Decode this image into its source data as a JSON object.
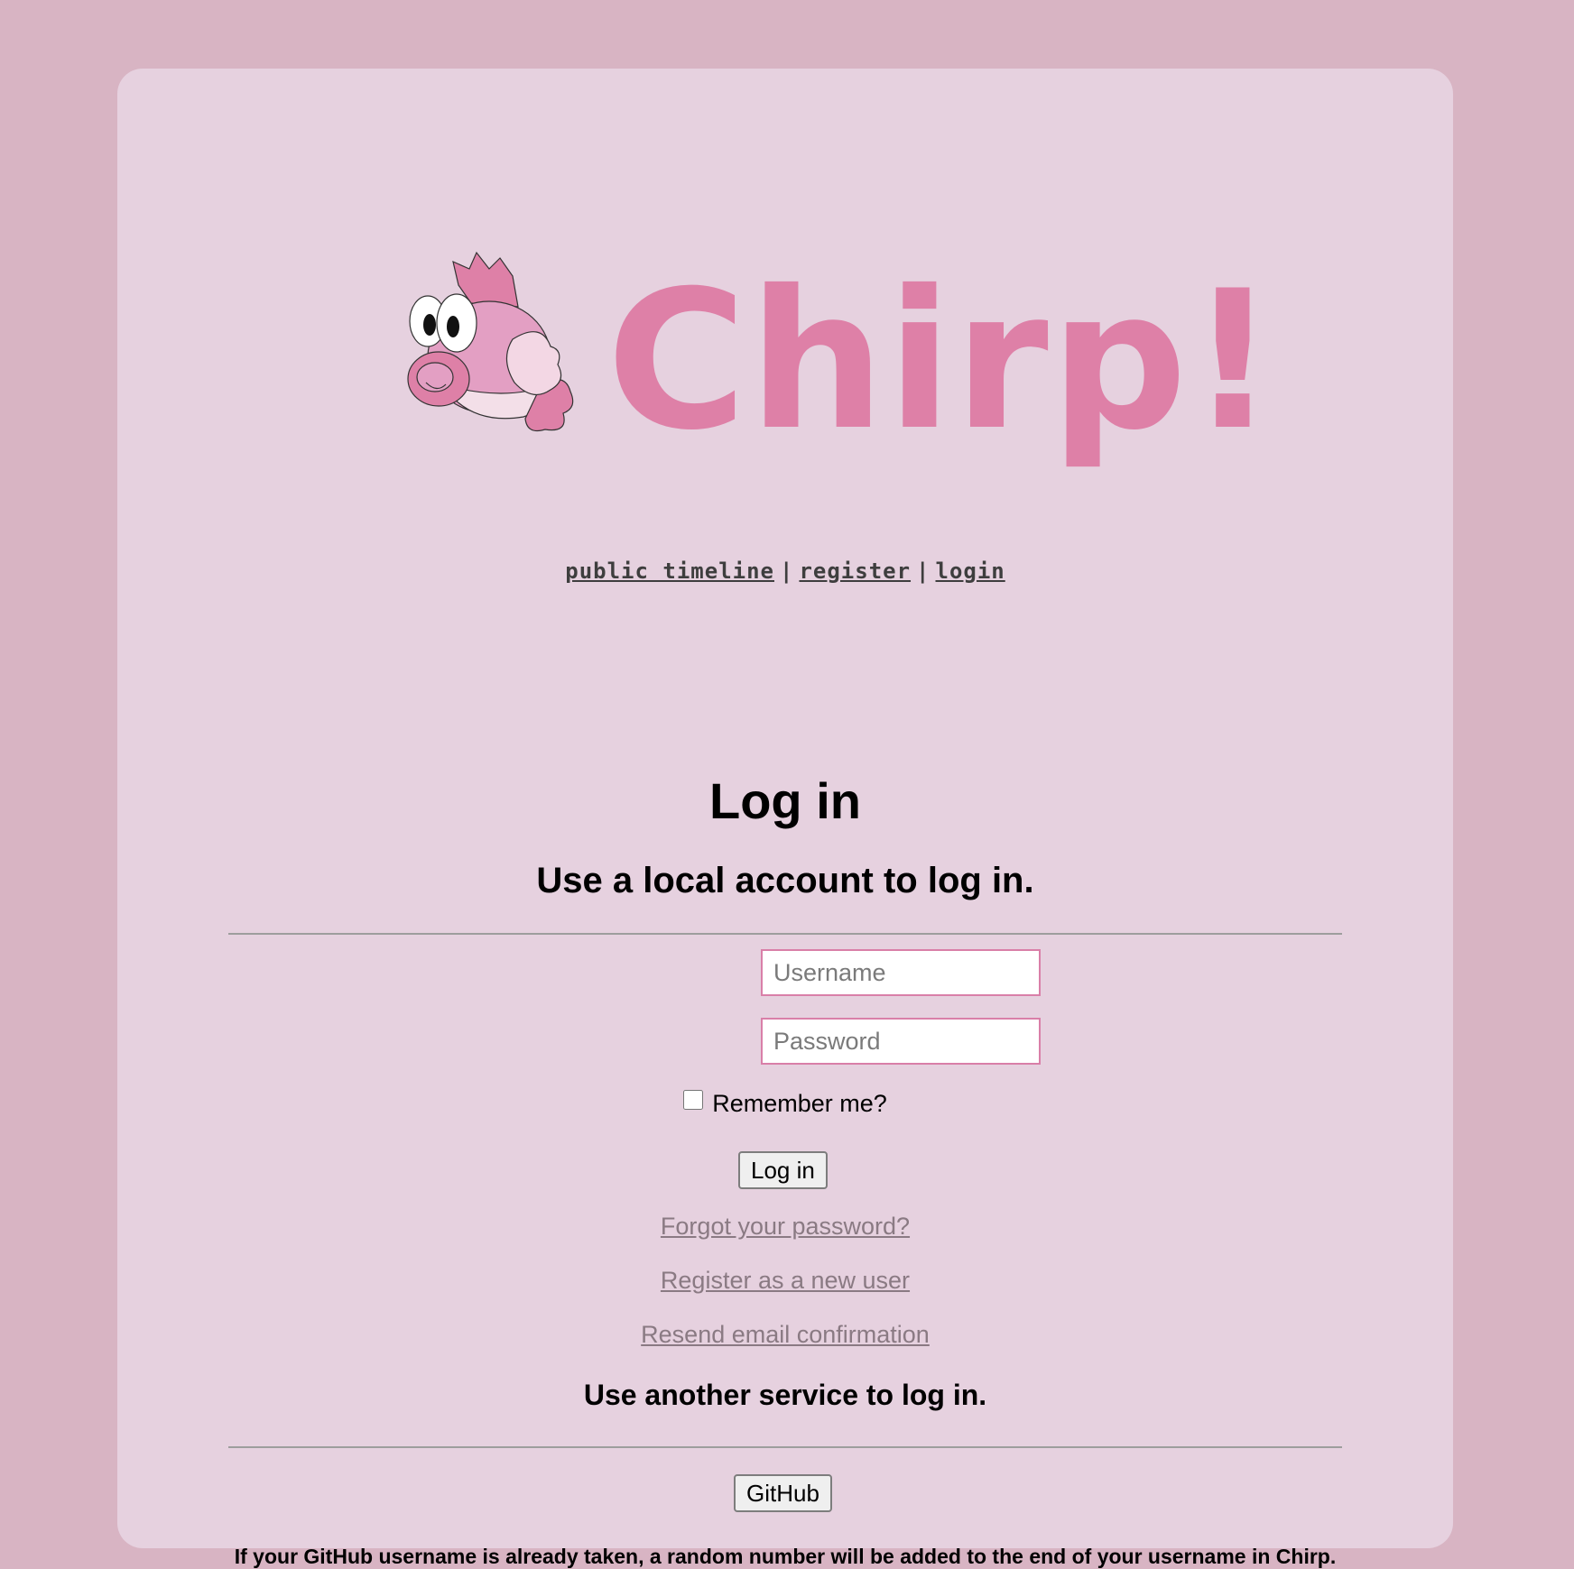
{
  "header": {
    "brand": "Chirp!",
    "nav": {
      "public_timeline": "public timeline",
      "separator": "|",
      "register": "register",
      "login": "login"
    }
  },
  "main": {
    "title": "Log in",
    "local_heading": "Use a local account to log in.",
    "username_placeholder": "Username",
    "password_placeholder": "Password",
    "remember_label": "Remember me?",
    "login_button": "Log in",
    "forgot_link": "Forgot your password?",
    "register_link": "Register as a new user",
    "resend_link": "Resend email confirmation",
    "external_heading": "Use another service to log in.",
    "github_button": "GitHub",
    "github_note": "If your GitHub username is already taken, a random number will be added to the end of your username in Chirp."
  },
  "colors": {
    "background": "#d8b4c3",
    "panel": "#e6d1df",
    "brand": "#de80a7",
    "input_border": "#d97fa8",
    "link": "#8a7a83"
  }
}
